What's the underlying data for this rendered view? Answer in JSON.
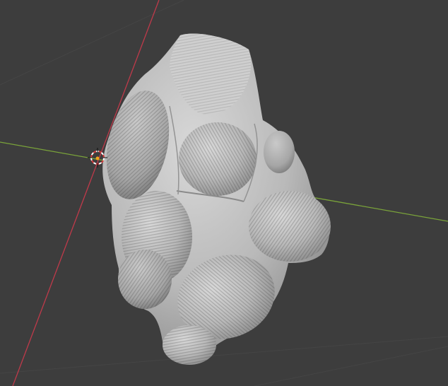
{
  "viewport": {
    "mode": "3d-viewport",
    "background_color": "#3d3d3d",
    "grid_line_color": "#454545",
    "axes": {
      "x_axis_color": "#bf3a4a",
      "y_axis_color": "#7aa33a"
    },
    "mesh": {
      "object": "sculpted-blob-mesh",
      "shading": "solid",
      "base_color": "#bdbdbd"
    },
    "cursor_3d": {
      "icon": "3d-cursor-icon",
      "ring_color_a": "#ffffff",
      "ring_color_b": "#d43a3a",
      "origin_color": "#f2a31b"
    }
  }
}
